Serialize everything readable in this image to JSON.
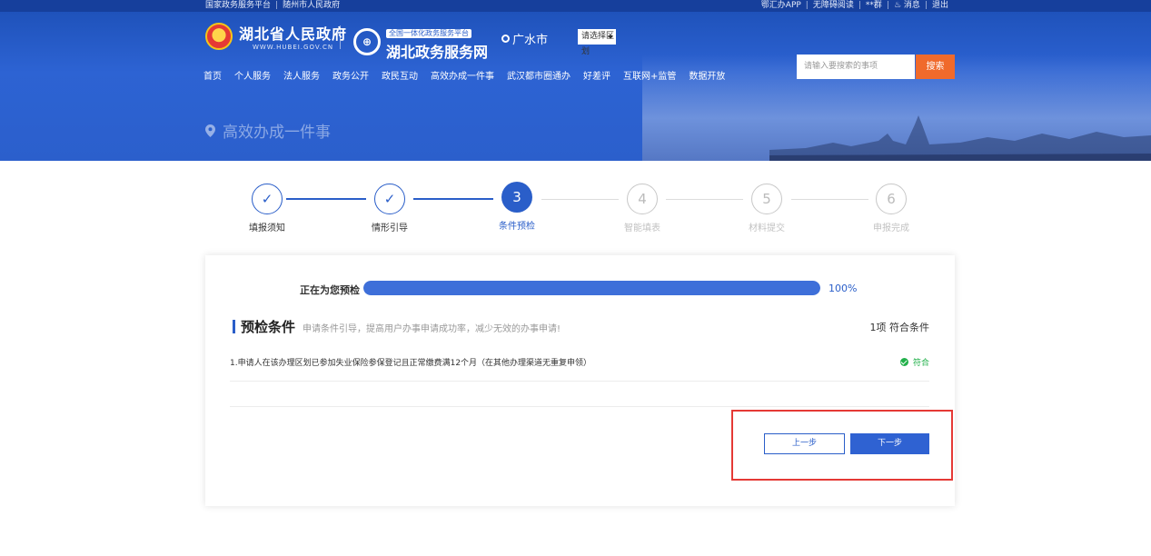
{
  "topbar": {
    "left_links": [
      "国家政务服务平台",
      "随州市人民政府"
    ],
    "right_links": [
      "鄂汇办APP",
      "无障碍阅读",
      "**群",
      "消息",
      "退出"
    ]
  },
  "header": {
    "gov_name": "湖北省人民政府",
    "gov_url": "WWW.HUBEI.GOV.CN",
    "platform_tag": "全国一体化政务服务平台",
    "platform_name": "湖北政务服务网",
    "city": "广水市",
    "district_select": "请选择区划",
    "search_placeholder": "请输入要搜索的事项",
    "search_button": "搜索",
    "nav": [
      "首页",
      "个人服务",
      "法人服务",
      "政务公开",
      "政民互动",
      "高效办成一件事",
      "武汉都市圈通办",
      "好差评",
      "互联网+监管",
      "数据开放"
    ]
  },
  "banner": {
    "title": "高效办成一件事"
  },
  "steps": [
    {
      "num": "1",
      "label": "填报须知",
      "state": "done"
    },
    {
      "num": "2",
      "label": "情形引导",
      "state": "done"
    },
    {
      "num": "3",
      "label": "条件预检",
      "state": "active"
    },
    {
      "num": "4",
      "label": "智能填表",
      "state": "todo"
    },
    {
      "num": "5",
      "label": "材料提交",
      "state": "todo"
    },
    {
      "num": "6",
      "label": "申报完成",
      "state": "todo"
    }
  ],
  "precheck": {
    "label": "正在为您预检",
    "progress": 1.0,
    "progress_text": "100%",
    "section_title": "预检条件",
    "section_subtitle": "申请条件引导，提高用户办事申请成功率，减少无效的办事申请!",
    "count_text": "1项 符合条件",
    "conditions": [
      {
        "text": "1.申请人在该办理区划已参加失业保险参保登记且正常缴费满12个月（在其他办理渠道无重复申领）",
        "status": "符合"
      }
    ]
  },
  "actions": {
    "prev": "上一步",
    "next": "下一步"
  },
  "colors": {
    "primary": "#2a5ec9",
    "search": "#f06a2b",
    "ok": "#21b04a",
    "highlight": "#e53935"
  }
}
